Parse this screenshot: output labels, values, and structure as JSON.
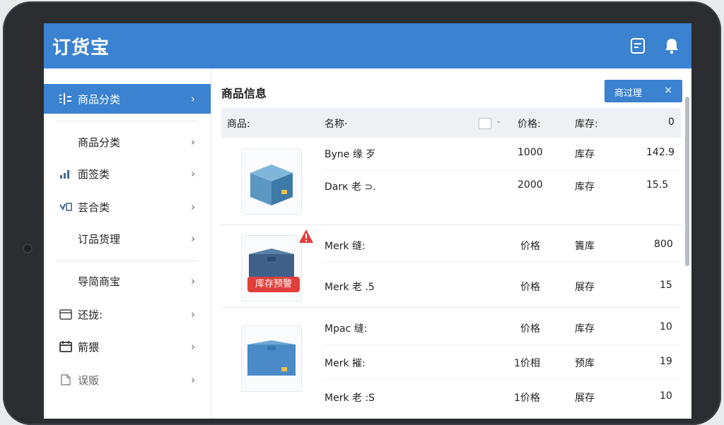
{
  "app": {
    "title": "订货宝"
  },
  "header": {
    "notes_icon": "notes-icon",
    "bell_icon": "bell-icon"
  },
  "sidebar": {
    "items": [
      {
        "label": "商品分类",
        "icon": "list-icon",
        "active": true
      },
      {
        "label": "商品分类",
        "icon": ""
      },
      {
        "label": "面签类",
        "icon": "bar-chart-icon"
      },
      {
        "label": "芸合类",
        "icon": "check-icon"
      },
      {
        "label": "订品货理",
        "icon": ""
      },
      {
        "label": "导简商宝",
        "icon": ""
      },
      {
        "label": "还拢:",
        "icon": "calendar-icon"
      },
      {
        "label": "箭猥",
        "icon": "calendar-icon"
      },
      {
        "label": "误贩",
        "icon": "document-icon"
      }
    ]
  },
  "main": {
    "title": "商品信息",
    "filter": {
      "label": "商过理",
      "close": "×"
    },
    "columns": {
      "product": "商品:",
      "name": "名称·",
      "price": "价格:",
      "stock": "库存:",
      "qty": "0"
    },
    "badge": "库存预警",
    "rows": [
      {
        "name": "Byne 缘 歹",
        "price": "1000",
        "stock": "库存",
        "qty": "142.9"
      },
      {
        "name": "Darк 老 ⊃.",
        "price": "2000",
        "stock": "库存",
        "qty": "15.5"
      },
      {
        "name": "Merk 缝:",
        "price": "价格",
        "stock": "簀库",
        "qty": "800"
      },
      {
        "name": "Merk 老 .5",
        "price": "价格",
        "stock": "展存",
        "qty": "15"
      },
      {
        "name": "Mpac 缝:",
        "price": "价格",
        "stock": "库存",
        "qty": "10"
      },
      {
        "name": "Merk 摧:",
        "price": "1价相",
        "stock": "预库",
        "qty": "19"
      },
      {
        "name": "Merk 老 :S",
        "price": "1价格",
        "stock": "展存",
        "qty": "10"
      }
    ]
  },
  "colors": {
    "accent": "#3b82d0",
    "warning": "#e13f3b"
  }
}
